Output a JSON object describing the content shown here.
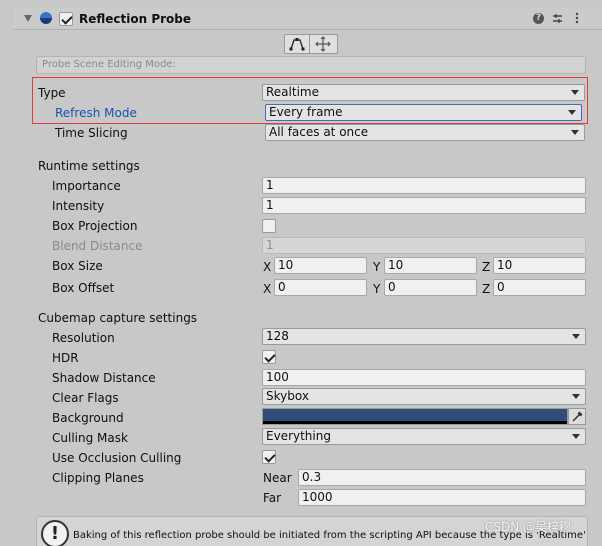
{
  "component": {
    "title": "Reflection Probe",
    "enabled": true
  },
  "scene_editing": {
    "placeholder": "Probe Scene Editing Mode:"
  },
  "type": {
    "label": "Type",
    "value": "Realtime"
  },
  "refresh_mode": {
    "label": "Refresh Mode",
    "value": "Every frame"
  },
  "time_slicing": {
    "label": "Time Slicing",
    "value": "All faces at once"
  },
  "runtime": {
    "header": "Runtime settings",
    "importance": {
      "label": "Importance",
      "value": "1"
    },
    "intensity": {
      "label": "Intensity",
      "value": "1"
    },
    "box_projection": {
      "label": "Box Projection",
      "checked": false
    },
    "blend_distance": {
      "label": "Blend Distance",
      "value": "1"
    },
    "box_size": {
      "label": "Box Size",
      "x": "10",
      "y": "10",
      "z": "10"
    },
    "box_offset": {
      "label": "Box Offset",
      "x": "0",
      "y": "0",
      "z": "0"
    }
  },
  "axes": {
    "x": "X",
    "y": "Y",
    "z": "Z"
  },
  "cubemap": {
    "header": "Cubemap capture settings",
    "resolution": {
      "label": "Resolution",
      "value": "128"
    },
    "hdr": {
      "label": "HDR",
      "checked": true
    },
    "shadow_distance": {
      "label": "Shadow Distance",
      "value": "100"
    },
    "clear_flags": {
      "label": "Clear Flags",
      "value": "Skybox"
    },
    "background": {
      "label": "Background",
      "color": "#2f4d78"
    },
    "culling_mask": {
      "label": "Culling Mask",
      "value": "Everything"
    },
    "occlusion": {
      "label": "Use Occlusion Culling",
      "checked": true
    },
    "clipping": {
      "label": "Clipping Planes",
      "near_label": "Near",
      "near": "0.3",
      "far_label": "Far",
      "far": "1000"
    }
  },
  "help": {
    "text": "Baking of this reflection probe should be initiated from the scripting API because the type is 'Realtime'",
    "icon": "warning-icon"
  },
  "watermark": "CSDN @吴梓穆",
  "colors": {
    "highlight": "#e03c3c",
    "accent_blue": "#1c4fb0"
  }
}
